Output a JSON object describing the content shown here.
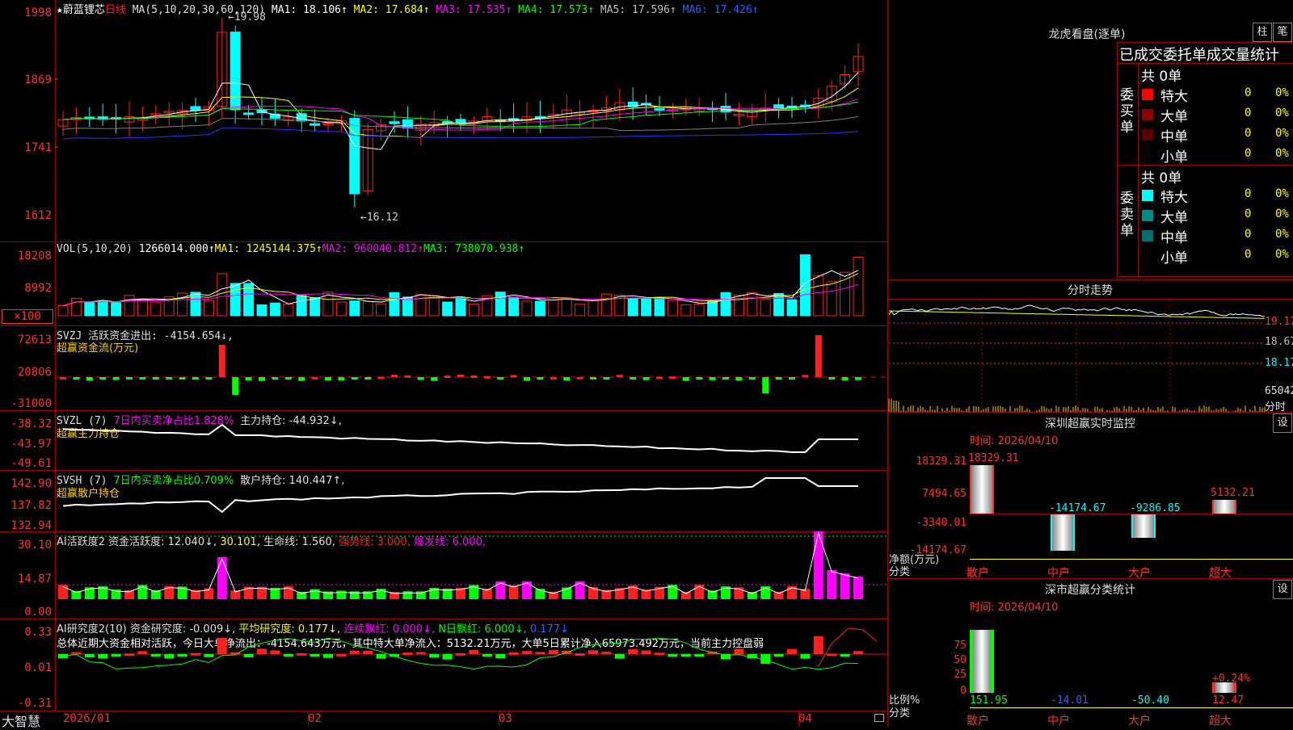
{
  "header": {
    "star": "★",
    "stock_name": "蔚蓝锂芯",
    "period": "日线",
    "ma_params": "MA(5,10,20,30,60,120)",
    "ma1": "MA1: 18.106↑",
    "ma2": "MA2: 17.684↑",
    "ma3": "MA3: 17.535↑",
    "ma4": "MA4: 17.573↑",
    "ma5": "MA5: 17.596↑",
    "ma6": "MA6: 17.426↑",
    "high_mark": "←19.98",
    "low_mark": "←16.12"
  },
  "price_axis": [
    "1998",
    "1869",
    "1741",
    "1612"
  ],
  "vol": {
    "title": "VOL(5,10,20)",
    "value": "1266014.000↑",
    "ma1": "MA1: 1245144.375↑",
    "ma2": "MA2: 960040.812↑",
    "ma3": "MA3: 738070.938↑",
    "axis": [
      "18208",
      "8992",
      "×100"
    ]
  },
  "svzj": {
    "title": "SVZJ  活跃资金进出: -4154.654↓,",
    "desc": "超赢资金流(万元)",
    "axis": [
      "72613",
      "20806",
      "-31000"
    ]
  },
  "svzl": {
    "title": "SVZL  (7)",
    "sub1": "7日内买卖净占比1.828%",
    "sub2": "主力持仓: -44.932↓,",
    "desc": "超赢主力持仓",
    "axis": [
      "-38.32",
      "-43.97",
      "-49.61"
    ]
  },
  "svsh": {
    "title": "SVSH  (7)",
    "sub1": "7日内买卖净占比0.709%",
    "sub2": "散户持仓: 140.447↑,",
    "desc": "超赢散户持仓",
    "axis": [
      "142.90",
      "137.82",
      "132.94"
    ]
  },
  "ai_active": {
    "title": "AI活跃度2",
    "v1": "资金活跃度: 12.040↓,",
    "v2": "30.101,",
    "v3": "生命线: 1.560,",
    "v4": "强势线: 3.000,",
    "v5": "爆发线: 6.000,",
    "axis": [
      "30.10",
      "14.87",
      "0.00"
    ]
  },
  "ai_research": {
    "title": "AI研究度2(10)",
    "v1": "资金研究度: -0.009↓,",
    "v2": "平均研究度: 0.177↓,",
    "v3": "连续飘红: 0.000↓,",
    "v4": "N日飘红: 6.000↓,",
    "v5": "0.177↓",
    "summary": "总体近期大资金相对活跃，今日大单净流出：-4154.643万元，其中特大单净流入：5132.21万元，大单5日累计净入65973.492万元，当前主力控盘弱",
    "axis": [
      "0.33",
      "0.01",
      "-0.31"
    ]
  },
  "date_axis": [
    "2026/01",
    "02",
    "03",
    "04"
  ],
  "brand": "大智慧",
  "right": {
    "lhb_title": "龙虎看盘(逐单)",
    "btn_zhu": "柱",
    "btn_bi": "笔",
    "tab_line": "已成交委托单成交量统计",
    "buy_label": "委买单",
    "sell_label": "委卖单",
    "buy_total": "共 0单",
    "sell_total": "共 0单",
    "buy_rows": [
      {
        "name": "特大",
        "count": "0",
        "pct": "0%",
        "color": "#ff0000"
      },
      {
        "name": "大单",
        "count": "0",
        "pct": "0%",
        "color": "#8b0000"
      },
      {
        "name": "中单",
        "count": "0",
        "pct": "0%",
        "color": "#5a0000"
      },
      {
        "name": "小单",
        "count": "0",
        "pct": "0%",
        "color": "#000000"
      }
    ],
    "sell_rows": [
      {
        "name": "特大",
        "count": "0",
        "pct": "0%",
        "color": "#00ffff"
      },
      {
        "name": "大单",
        "count": "0",
        "pct": "0%",
        "color": "#008b8b"
      },
      {
        "name": "中单",
        "count": "0",
        "pct": "0%",
        "color": "#007070"
      },
      {
        "name": "小单",
        "count": "0",
        "pct": "0%",
        "color": "#000000"
      }
    ],
    "intraday_title": "分时走势",
    "intraday_axis": [
      "19.17",
      "18.67",
      "18.17",
      "65042",
      "分时"
    ],
    "sz_monitor_title": "深圳超赢实时监控",
    "btn_set": "设",
    "sz_time": "时间: 2026/04/10",
    "sz_axis": [
      "18329.31",
      "7494.65",
      "-3340.01",
      "-14174.67"
    ],
    "sz_axis_label1": "净额(万元)",
    "sz_axis_label2": "分类",
    "sz_bars": [
      {
        "cat": "散户",
        "value": "18329.31"
      },
      {
        "cat": "中户",
        "value": "-14174.67"
      },
      {
        "cat": "大户",
        "value": "-9286.85"
      },
      {
        "cat": "超大",
        "value": "5132.21"
      }
    ],
    "class_stat_title": "深市超赢分类统计",
    "class_time": "时间: 2026/04/10",
    "class_axis": [
      "75",
      "50",
      "25",
      "0"
    ],
    "class_axis_label1": "比例%",
    "class_axis_label2": "分类",
    "class_bars": [
      {
        "cat": "散户",
        "value": "151.95",
        "pct": 151.95
      },
      {
        "cat": "中户",
        "value": "-14.01",
        "pct": -14.01
      },
      {
        "cat": "大户",
        "value": "-50.40",
        "pct": -50.4
      },
      {
        "cat": "超大",
        "value": "12.47",
        "pct": 12.47,
        "label": "+0.24%"
      }
    ]
  },
  "colors": {
    "up": "#ff2020",
    "down": "#00ffff",
    "grid": "#a00000",
    "ma1": "#ffffff",
    "ma2": "#ffff00",
    "ma3": "#ff00ff",
    "ma4": "#00ff00",
    "ma5": "#808080",
    "ma6": "#3030ff"
  }
}
